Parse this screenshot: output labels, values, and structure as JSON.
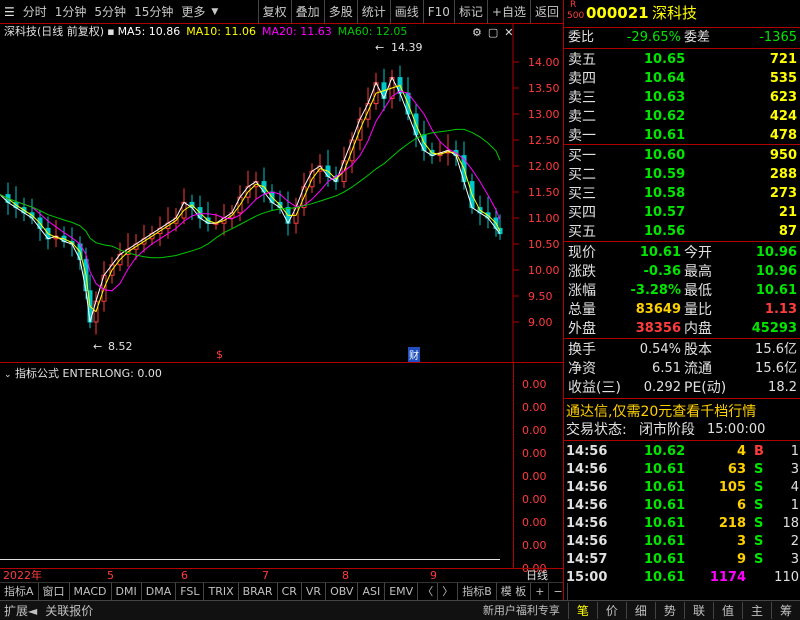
{
  "toolbar": {
    "left_items": [
      "分时",
      "1分钟",
      "5分钟",
      "15分钟",
      "更多"
    ],
    "right_items": [
      "复权",
      "叠加",
      "多股",
      "统计",
      "画线",
      "F10",
      "标记",
      "+自选",
      "返回"
    ]
  },
  "chart_header": {
    "title": "深科技(日线 前复权)",
    "ma5": "MA5: 10.86",
    "ma10": "MA10: 11.06",
    "ma20": "MA20: 11.63",
    "ma60": "MA60: 12.05"
  },
  "price_axis": [
    "14.00",
    "13.50",
    "13.00",
    "12.50",
    "12.00",
    "11.50",
    "11.00",
    "10.50",
    "10.00",
    "9.50",
    "9.00"
  ],
  "annotations": {
    "high": "14.39",
    "low": "8.52",
    "mark_s": "$",
    "mark_cai": "财"
  },
  "indicator": {
    "title": "指标公式 ENTERLONG: 0.00",
    "axis": [
      "0.00",
      "0.00",
      "0.00",
      "0.00",
      "0.00",
      "0.00",
      "0.00",
      "0.00",
      "0.00"
    ]
  },
  "date_axis": {
    "year": "2022年",
    "months": [
      "5",
      "6",
      "7",
      "8",
      "9"
    ],
    "period": "日线"
  },
  "tabs": [
    "指标A",
    "窗口",
    "MACD",
    "DMI",
    "DMA",
    "FSL",
    "TRIX",
    "BRAR",
    "CR",
    "VR",
    "OBV",
    "ASI",
    "EMV",
    "〈",
    "〉",
    "指标B",
    "模 板",
    "+",
    "−"
  ],
  "bottom": {
    "left": [
      "扩展◄",
      "关联报价"
    ],
    "promo": "新用户福利专享",
    "tabs": [
      "笔",
      "价",
      "细",
      "势",
      "联",
      "值",
      "主",
      "筹"
    ]
  },
  "quote": {
    "badge_r": "R",
    "badge_num": "500",
    "code": "000021",
    "name": "深科技",
    "weibi_label": "委比",
    "weibi": "-29.65%",
    "weicha_label": "委差",
    "weicha": "-1365",
    "asks": [
      {
        "label": "卖五",
        "price": "10.65",
        "vol": "721"
      },
      {
        "label": "卖四",
        "price": "10.64",
        "vol": "535"
      },
      {
        "label": "卖三",
        "price": "10.63",
        "vol": "623"
      },
      {
        "label": "卖二",
        "price": "10.62",
        "vol": "424"
      },
      {
        "label": "卖一",
        "price": "10.61",
        "vol": "478"
      }
    ],
    "bids": [
      {
        "label": "买一",
        "price": "10.60",
        "vol": "950"
      },
      {
        "label": "买二",
        "price": "10.59",
        "vol": "288"
      },
      {
        "label": "买三",
        "price": "10.58",
        "vol": "273"
      },
      {
        "label": "买四",
        "price": "10.57",
        "vol": "21"
      },
      {
        "label": "买五",
        "price": "10.56",
        "vol": "87"
      }
    ],
    "stats": [
      {
        "l1": "现价",
        "v1": "10.61",
        "c1": "green",
        "l2": "今开",
        "v2": "10.96",
        "c2": "green"
      },
      {
        "l1": "涨跌",
        "v1": "-0.36",
        "c1": "green",
        "l2": "最高",
        "v2": "10.96",
        "c2": "green"
      },
      {
        "l1": "涨幅",
        "v1": "-3.28%",
        "c1": "green",
        "l2": "最低",
        "v2": "10.61",
        "c2": "green"
      },
      {
        "l1": "总量",
        "v1": "83649",
        "c1": "gold",
        "l2": "量比",
        "v2": "1.13",
        "c2": "red"
      },
      {
        "l1": "外盘",
        "v1": "38356",
        "c1": "red",
        "l2": "内盘",
        "v2": "45293",
        "c2": "green"
      }
    ],
    "fund": [
      {
        "l1": "换手",
        "v1": "0.54%",
        "l2": "股本",
        "v2": "15.6亿"
      },
      {
        "l1": "净资",
        "v1": "6.51",
        "l2": "流通",
        "v2": "15.6亿"
      },
      {
        "l1": "收益(三)",
        "v1": "0.292",
        "l2": "PE(动)",
        "v2": "18.2"
      }
    ],
    "promo": "通达信,仅需20元查看千档行情",
    "status_label": "交易状态:",
    "status_value": "闭市阶段",
    "status_time": "15:00:00",
    "ticks": [
      {
        "time": "14:56",
        "price": "10.62",
        "vol": "4",
        "bs": "B",
        "n": "1"
      },
      {
        "time": "14:56",
        "price": "10.61",
        "vol": "63",
        "bs": "S",
        "n": "3"
      },
      {
        "time": "14:56",
        "price": "10.61",
        "vol": "105",
        "bs": "S",
        "n": "4"
      },
      {
        "time": "14:56",
        "price": "10.61",
        "vol": "6",
        "bs": "S",
        "n": "1"
      },
      {
        "time": "14:56",
        "price": "10.61",
        "vol": "218",
        "bs": "S",
        "n": "18"
      },
      {
        "time": "14:56",
        "price": "10.61",
        "vol": "3",
        "bs": "S",
        "n": "2"
      },
      {
        "time": "14:57",
        "price": "10.61",
        "vol": "9",
        "bs": "S",
        "n": "3"
      },
      {
        "time": "15:00",
        "price": "10.61",
        "vol": "1174",
        "bs": "",
        "n": "110"
      }
    ]
  },
  "colors": {
    "up": "#ff3c3c",
    "down": "#00e600",
    "ma5": "#ffffff",
    "ma10": "#ffff00",
    "ma20": "#ff00ff",
    "ma60": "#00c800",
    "frame": "#b00000"
  }
}
